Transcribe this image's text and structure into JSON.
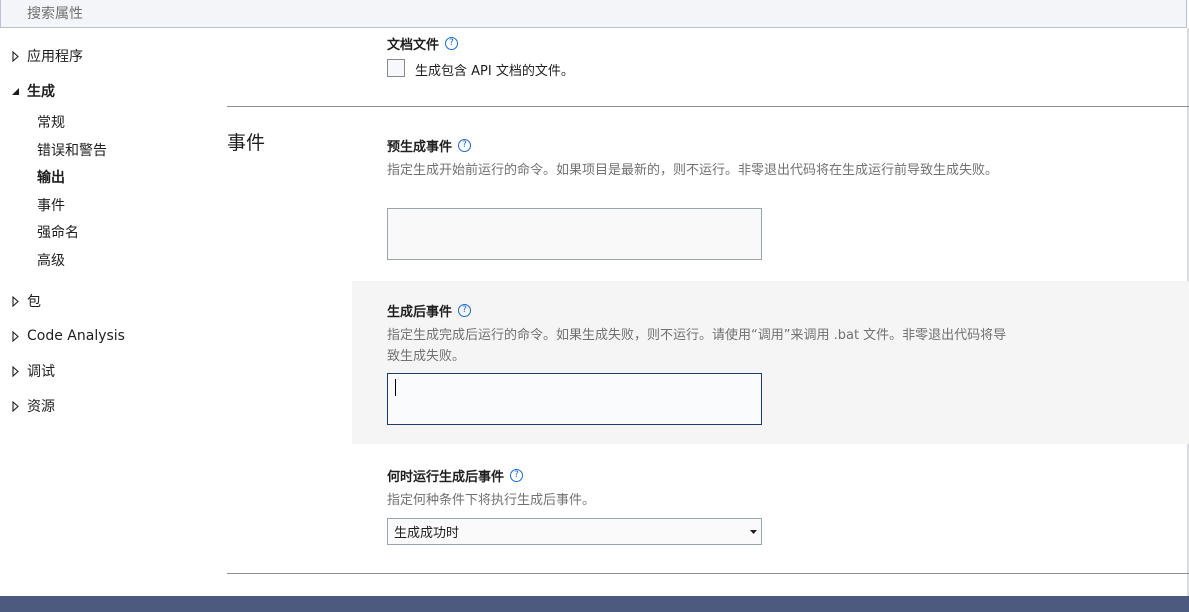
{
  "search": {
    "placeholder": "搜索属性"
  },
  "nav": {
    "groups": [
      {
        "label": "应用程序",
        "expanded": false
      },
      {
        "label": "生成",
        "expanded": true,
        "items": [
          {
            "label": "常规"
          },
          {
            "label": "错误和警告"
          },
          {
            "label": "输出",
            "active": true
          },
          {
            "label": "事件"
          },
          {
            "label": "强命名"
          },
          {
            "label": "高级"
          }
        ]
      },
      {
        "label": "包",
        "expanded": false
      },
      {
        "label": "Code Analysis",
        "expanded": false
      },
      {
        "label": "调试",
        "expanded": false
      },
      {
        "label": "资源",
        "expanded": false
      }
    ]
  },
  "doc_file": {
    "title": "文档文件",
    "checkbox_label": "生成包含 API 文档的文件。",
    "checked": false
  },
  "events": {
    "section_title": "事件",
    "pre_build": {
      "title": "预生成事件",
      "description": "指定生成开始前运行的命令。如果项目是最新的，则不运行。非零退出代码将在生成运行前导致生成失败。",
      "value": ""
    },
    "post_build": {
      "title": "生成后事件",
      "description": "指定生成完成后运行的命令。如果生成失败，则不运行。请使用“调用”来调用 .bat 文件。非零退出代码将导致生成失败。",
      "value": ""
    },
    "run_post_build": {
      "title": "何时运行生成后事件",
      "description": "指定何种条件下将执行生成后事件。",
      "selected": "生成成功时"
    }
  },
  "icons": {
    "help": "question-circle-icon",
    "expanded": "triangle-down-right-icon",
    "collapsed": "triangle-right-outline-icon",
    "dropdown": "caret-down-icon"
  },
  "colors": {
    "accent": "#1b6ac9",
    "bottom_bar": "#4c5a80",
    "focus_border": "#1e3a6c"
  }
}
